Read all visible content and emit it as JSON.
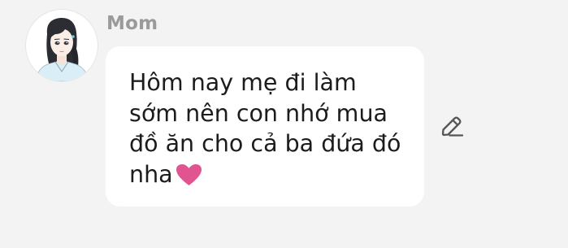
{
  "message": {
    "sender": "Mom",
    "avatar_icon": "woman-avatar-icon",
    "text": "Hôm nay mẹ đi làm sớm nên con nhớ mua đồ ăn cho cả ba đứa đó nha",
    "emoji_icon": "heart-icon",
    "heart_color": "#e0548f"
  },
  "actions": {
    "edit_icon": "pencil-edit-icon"
  },
  "colors": {
    "background": "#f3f3f3",
    "bubble": "#ffffff",
    "sender_name": "#9a9a9a",
    "text": "#1c1c1c",
    "icon": "#555555"
  }
}
